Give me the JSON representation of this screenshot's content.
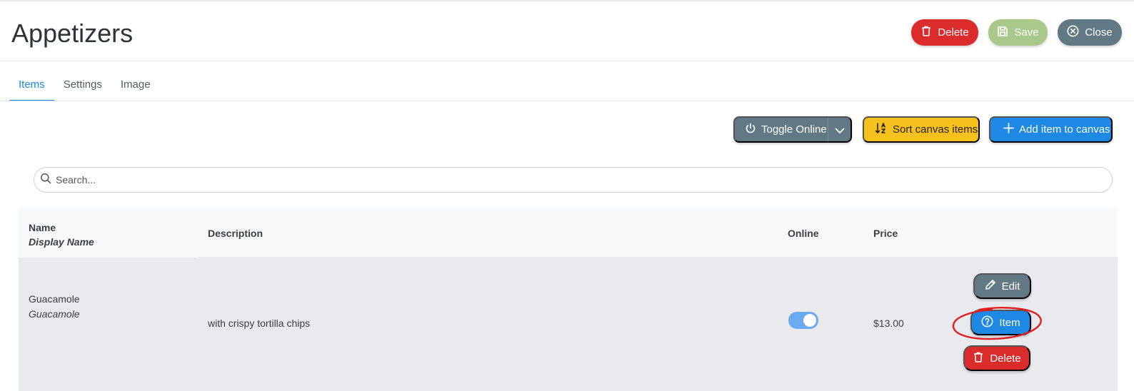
{
  "page": {
    "title": "Appetizers"
  },
  "header_actions": {
    "delete_label": "Delete",
    "save_label": "Save",
    "close_label": "Close"
  },
  "tabs": [
    {
      "label": "Items",
      "active": true
    },
    {
      "label": "Settings",
      "active": false
    },
    {
      "label": "Image",
      "active": false
    }
  ],
  "toolbar": {
    "toggle_online_label": "Toggle Online",
    "sort_label": "Sort canvas items",
    "add_label": "Add item to canvas"
  },
  "search": {
    "placeholder": "Search...",
    "value": ""
  },
  "table": {
    "headers": {
      "name": "Name",
      "display_name": "Display Name",
      "description": "Description",
      "online": "Online",
      "price": "Price"
    },
    "rows": [
      {
        "name": "Guacamole",
        "display_name": "Guacamole",
        "description": "with crispy tortilla chips",
        "online": true,
        "price": "$13.00",
        "actions": {
          "edit_label": "Edit",
          "item_label": "Item",
          "delete_label": "Delete"
        }
      }
    ]
  },
  "colors": {
    "primary": "#1e88e5",
    "danger": "#dc2b2b",
    "success_disabled": "#a8c98a",
    "secondary": "#607985",
    "warning": "#f6c11c",
    "annotation": "#e02020"
  },
  "icons": {
    "delete": "trash-icon",
    "save": "floppy-icon",
    "close": "circle-x-icon",
    "toggle": "power-icon",
    "dropdown": "chevron-down-icon",
    "sort": "sort-icon",
    "add": "plus-icon",
    "search": "search-icon",
    "edit": "pencil-icon",
    "item": "question-circle-icon"
  }
}
